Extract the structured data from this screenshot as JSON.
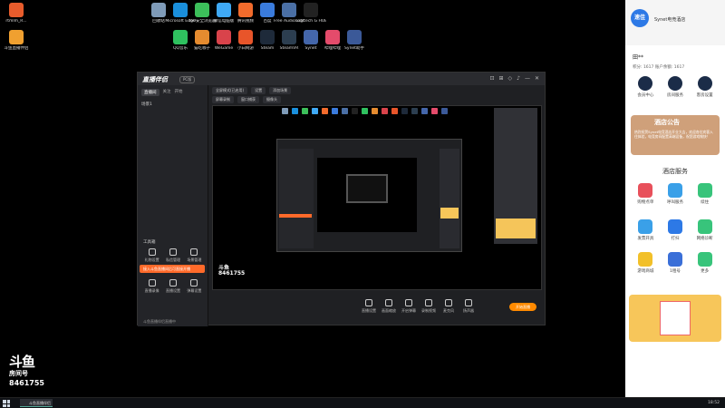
{
  "desktop": {
    "icons_left": [
      {
        "label": "rtmlm_R...",
        "color": "#e85c2c"
      },
      {
        "label": "斗鱼直播伴侣",
        "color": "#f0a030"
      }
    ],
    "icons_top_row1": [
      {
        "label": "回收站",
        "color": "#7f9bb8"
      },
      {
        "label": "Microsoft Edge",
        "color": "#1a8fdc"
      },
      {
        "label": "360安全浏览器",
        "color": "#3cbf5a"
      },
      {
        "label": "微信电脑版",
        "color": "#3fa9f5"
      },
      {
        "label": "腾讯视频",
        "color": "#f26b2c"
      },
      {
        "label": "百度",
        "color": "#3a7bdc"
      },
      {
        "label": "Free Audio Editor",
        "color": "#4a6fa5"
      },
      {
        "label": "Logitech G HUB",
        "color": "#222222"
      }
    ],
    "icons_top_row2": [
      {
        "label": "QQ音乐",
        "color": "#2fc15f"
      },
      {
        "label": "猫吃咖子",
        "color": "#e58b2f"
      },
      {
        "label": "WeGame",
        "color": "#d9434b"
      },
      {
        "label": "小白网游",
        "color": "#e8552a"
      },
      {
        "label": "Steam",
        "color": "#1e2a3a"
      },
      {
        "label": "SteamVR",
        "color": "#2c3e50"
      },
      {
        "label": "Synet",
        "color": "#4466aa"
      },
      {
        "label": "哔哩哔哩",
        "color": "#e44b6b"
      },
      {
        "label": "Synet助手",
        "color": "#3b5998"
      }
    ]
  },
  "app": {
    "logo": "直播伴侣",
    "badge": "PC版",
    "side_tabs": [
      "直播间",
      "关注",
      "开始"
    ],
    "side_row": "场景1",
    "section_label": "工具箱",
    "tools": [
      "礼物设置",
      "私信管理",
      "场景管理",
      "直播录像",
      "直播设置",
      "弹幕设置",
      "工具箱"
    ],
    "orange_bar": "接入斗鱼直播间后可直接开播",
    "status": "斗鱼直播伴侣直播中",
    "toolbar_pills": [
      "全屏模式(已启用)",
      "设置",
      "添加场景",
      "屏幕录制",
      "窗口捕获",
      "摄像头"
    ],
    "win_controls": [
      "⊡",
      "⊞",
      "◇",
      "♪",
      "—",
      "✕"
    ],
    "bottom_tools": [
      "直播设置",
      "画面缩放",
      "开启弹幕",
      "录制视频",
      "麦克风",
      "扬声器"
    ],
    "start_button": "开始直播",
    "watermark_small": "斗鱼\n8461755"
  },
  "panel": {
    "logo": "速佳",
    "name": "Synet电竞酒店",
    "user": "田**",
    "stats": "积分: 1617   账户余额: 1617",
    "row1": [
      {
        "label": "会员中心",
        "color": "#1b2c48"
      },
      {
        "label": "房间服务",
        "color": "#1b2c48"
      },
      {
        "label": "客房设置",
        "color": "#1b2c48"
      }
    ],
    "notice_title": "酒店公告",
    "notice_body": "热烈祝贺Synet电竞酒店开业大吉，欢迎各位宾客入住体验，电竞房间配置高端设备，祝您游戏愉快！",
    "service_title": "酒店服务",
    "row2": [
      {
        "label": "购物点单",
        "color": "#e8505b"
      },
      {
        "label": "呼叫服务",
        "color": "#3aa0e8"
      },
      {
        "label": "续住",
        "color": "#38c47b"
      }
    ],
    "row3": [
      {
        "label": "发票开具",
        "color": "#3aa0e8"
      },
      {
        "label": "打扫",
        "color": "#2d79e6"
      },
      {
        "label": "网络诊断",
        "color": "#38c47b"
      }
    ],
    "row4": [
      {
        "label": "游戏商城",
        "color": "#f2c029"
      },
      {
        "label": "1租号",
        "color": "#3a6fd8"
      },
      {
        "label": "更多",
        "color": "#38c47b"
      }
    ]
  },
  "watermark": {
    "big": "斗鱼",
    "sub": "房间号",
    "num": "8461755"
  },
  "taskbar": {
    "item": "斗鱼直播伴侣",
    "time": "18:52"
  }
}
